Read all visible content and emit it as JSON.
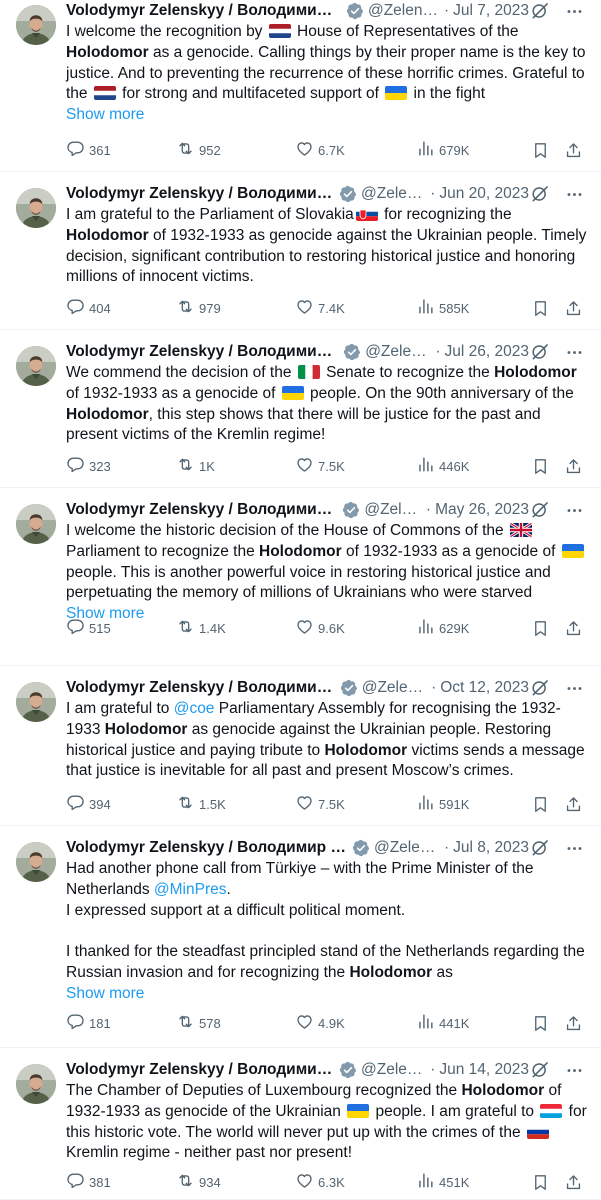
{
  "tweets": [
    {
      "name": "Volodymyr Zelenskyy / Володимир З...",
      "handle": "@Zelens...",
      "date": "Jul 7, 2023",
      "segments": [
        {
          "t": "I welcome the recognition by "
        },
        {
          "flag": "nl"
        },
        {
          "t": " House of Representatives of the "
        },
        {
          "b": "Holodomor"
        },
        {
          "t": " as a genocide. Calling things by their proper name is the key to justice. And to preventing the recurrence of these horrific crimes. Grateful to the "
        },
        {
          "flag": "nl"
        },
        {
          "t": " for strong and multifaceted support of "
        },
        {
          "flag": "ua"
        },
        {
          "t": " in the fight"
        }
      ],
      "show_more": "Show more",
      "replies": "361",
      "retweets": "952",
      "likes": "6.7K",
      "views": "679K"
    },
    {
      "name": "Volodymyr Zelenskyy / Володимир ...",
      "handle": "@Zelen...",
      "date": "Jun 20, 2023",
      "segments": [
        {
          "t": "I am grateful to the Parliament of Slovakia"
        },
        {
          "flag": "sk"
        },
        {
          "t": " for recognizing the "
        },
        {
          "b": "Holodomor"
        },
        {
          "t": " of 1932-1933 as genocide against the Ukrainian people. Timely decision, significant contribution to restoring historical justice and honoring millions of innocent victims."
        }
      ],
      "replies": "404",
      "retweets": "979",
      "likes": "7.4K",
      "views": "585K"
    },
    {
      "name": "Volodymyr Zelenskyy / Володимир ...",
      "handle": "@Zelen...",
      "date": "Jul 26, 2023",
      "segments": [
        {
          "t": "We commend the decision of the "
        },
        {
          "flag": "it"
        },
        {
          "t": " Senate to recognize the "
        },
        {
          "b": "Holodomor"
        },
        {
          "t": " of 1932-1933 as a genocide of "
        },
        {
          "flag": "ua"
        },
        {
          "t": " people. On the 90th anniversary of the "
        },
        {
          "b": "Holodomor"
        },
        {
          "t": ", this step shows that there will be justice for the past and present victims of the Kremlin regime!"
        }
      ],
      "replies": "323",
      "retweets": "1K",
      "likes": "7.5K",
      "views": "446K"
    },
    {
      "name": "Volodymyr Zelenskyy / Володимир ...",
      "handle": "@Zele...",
      "date": "May 26, 2023",
      "segments": [
        {
          "t": "I welcome the historic decision of the House of Commons of the "
        },
        {
          "flag": "gb"
        },
        {
          "t": " Parliament to recognize the "
        },
        {
          "b": "Holodomor"
        },
        {
          "t": " of 1932-1933 as a genocide of "
        },
        {
          "flag": "ua"
        },
        {
          "t": " people. This is another powerful voice in restoring historical justice and perpetuating the memory of millions of Ukrainians who were starved"
        }
      ],
      "show_more": "Show more",
      "replies": "515",
      "retweets": "1.4K",
      "likes": "9.6K",
      "views": "629K"
    },
    {
      "name": "Volodymyr Zelenskyy / Володимир ...",
      "handle": "@Zelen...",
      "date": "Oct 12, 2023",
      "segments": [
        {
          "t": "I am grateful to "
        },
        {
          "link": "@coe"
        },
        {
          "t": " Parliamentary Assembly for recognising the 1932-1933 "
        },
        {
          "b": "Holodomor"
        },
        {
          "t": " as genocide against the Ukrainian people. Restoring historical justice and paying tribute to "
        },
        {
          "b": "Holodomor"
        },
        {
          "t": " victims sends a message that justice is inevitable for all past and present Moscow’s crimes."
        }
      ],
      "replies": "394",
      "retweets": "1.5K",
      "likes": "7.5K",
      "views": "591K"
    },
    {
      "name": "Volodymyr Zelenskyy / Володимир З...",
      "handle": "@Zelen...",
      "date": "Jul 8, 2023",
      "segments": [
        {
          "t": "Had another phone call from Türkiye – with the Prime Minister of the Netherlands "
        },
        {
          "link": "@MinPres"
        },
        {
          "t": "."
        },
        {
          "br": true
        },
        {
          "t": "I expressed support at a difficult political moment."
        },
        {
          "gap": true
        },
        {
          "t": "I thanked for the steadfast principled stand of the Netherlands regarding the Russian invasion and for recognizing the "
        },
        {
          "b": "Holodomor"
        },
        {
          "t": " as"
        }
      ],
      "show_more": "Show more",
      "replies": "181",
      "retweets": "578",
      "likes": "4.9K",
      "views": "441K"
    },
    {
      "name": "Volodymyr Zelenskyy / Володимир ...",
      "handle": "@Zelen...",
      "date": "Jun 14, 2023",
      "segments": [
        {
          "t": "The Chamber of Deputies of Luxembourg recognized the "
        },
        {
          "b": "Holodomor"
        },
        {
          "t": " of 1932-1933 as genocide of the Ukrainian "
        },
        {
          "flag": "ua"
        },
        {
          "t": " people. I am grateful to "
        },
        {
          "flag": "lu"
        },
        {
          "t": " for this historic vote. The world will never put up with the crimes of the "
        },
        {
          "flag": "ru"
        },
        {
          "t": " Kremlin regime - neither past nor present!"
        }
      ],
      "replies": "381",
      "retweets": "934",
      "likes": "6.3K",
      "views": "451K"
    }
  ],
  "icons": {
    "verified": "verified-badge-icon",
    "grok": "grok-icon",
    "more": "more-options-icon",
    "reply": "reply-icon",
    "retweet": "retweet-icon",
    "like": "like-icon",
    "views": "views-icon",
    "bookmark": "bookmark-icon",
    "share": "share-icon"
  },
  "colors": {
    "text": "#0f1419",
    "secondary": "#536471",
    "link": "#1d9bf0",
    "verified_badge": "#829aab",
    "divider": "#eff3f4"
  }
}
